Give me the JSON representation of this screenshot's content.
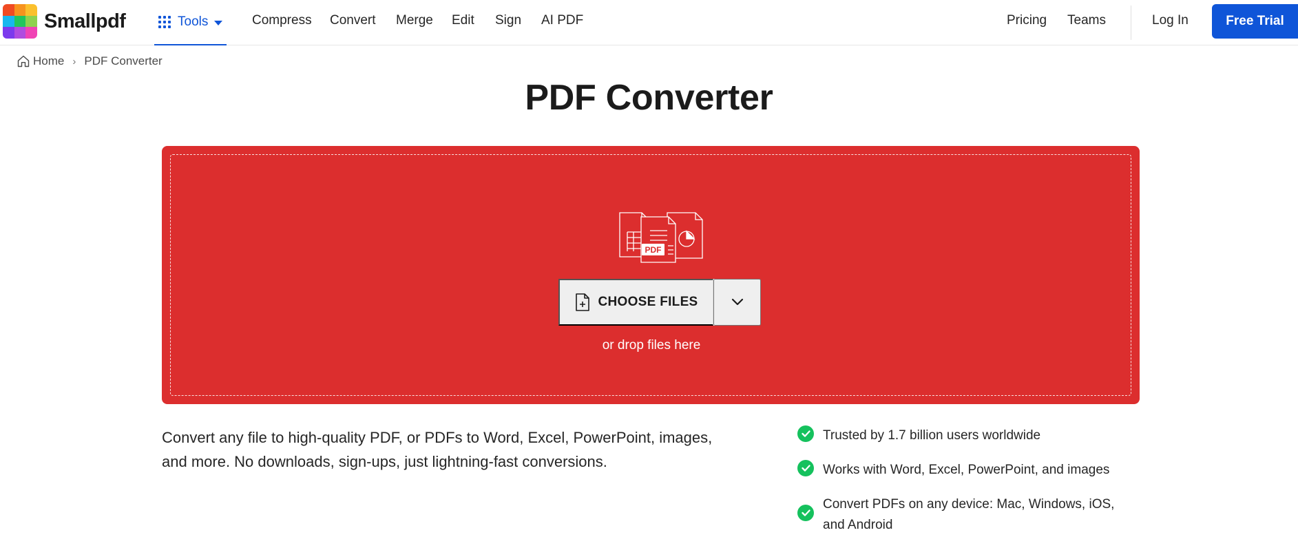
{
  "header": {
    "brand": "Smallpdf",
    "logo_colors": [
      "#f04b23",
      "#f7931e",
      "#fbc02d",
      "#18b7ee",
      "#22c55e",
      "#8fd14f",
      "#7c3aed",
      "#b04ce0",
      "#f043b5"
    ],
    "tools_label": "Tools",
    "nav": [
      "Compress",
      "Convert",
      "Merge",
      "Edit",
      "Sign",
      "AI PDF"
    ],
    "right_links": [
      "Pricing",
      "Teams"
    ],
    "login": "Log In",
    "trial": "Free Trial",
    "accent": "#0f55d8"
  },
  "breadcrumb": {
    "home": "Home",
    "separator": "›",
    "current": "PDF Converter"
  },
  "page_title": "PDF Converter",
  "dropzone": {
    "color": "#dc2e2e",
    "illustration_label": "PDF",
    "choose_files": "CHOOSE FILES",
    "drop_hint": "or drop files here"
  },
  "description": "Convert any file to high-quality PDF, or PDFs to Word, Excel, PowerPoint, images, and more. No downloads, sign-ups, just lightning-fast conversions.",
  "features": [
    "Trusted by 1.7 billion users worldwide",
    "Works with Word, Excel, PowerPoint, and images",
    "Convert PDFs on any device: Mac, Windows, iOS, and Android"
  ],
  "check_color": "#15c15d"
}
